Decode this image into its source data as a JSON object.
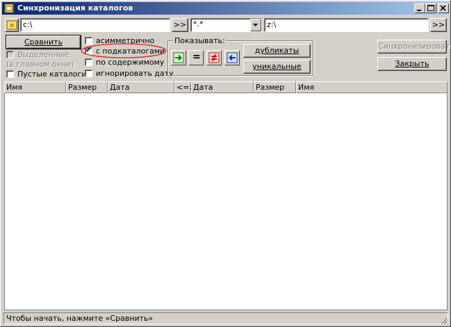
{
  "window": {
    "title": "Синхронизация каталогов"
  },
  "toolbar": {
    "left_path": "c:\\",
    "left_browse": ">>",
    "mask": "*.*",
    "right_path": "z:\\",
    "right_browse": ">>"
  },
  "actions": {
    "compare": "Сравнить",
    "sync": "Синхронизировать",
    "close": "Закрыть"
  },
  "options": {
    "selected_line1": "Выделенные",
    "selected_line2": "(в главном окне)",
    "empty_dirs": "Пустые каталоги",
    "asymmetric": "асимметрично",
    "subdirs": "с подкаталогами",
    "by_content": "по содержимому",
    "ignore_date": "игнорировать дату",
    "subdirs_checked": true
  },
  "show": {
    "label": "Показывать:",
    "equal": "=",
    "duplicates": "дубликаты",
    "unique": "уникальные"
  },
  "columns": [
    "Имя",
    "Размер",
    "Дата",
    "<=>",
    "Дата",
    "Размер",
    "Имя"
  ],
  "status": "Чтобы начать, нажмите «Сравнить»",
  "colors": {
    "annotation": "#e02020",
    "title_start": "#0a246a",
    "title_end": "#a6caf0"
  }
}
